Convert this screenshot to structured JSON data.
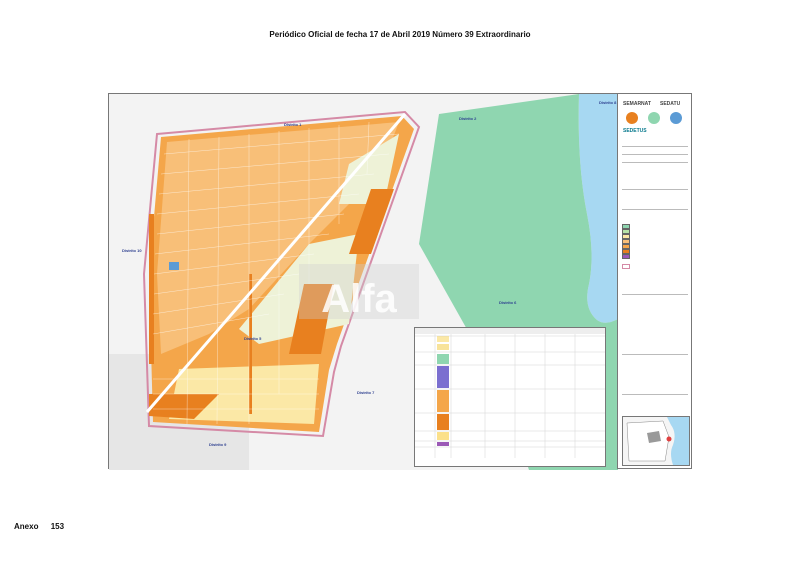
{
  "header": {
    "title": "Periódico Oficial de fecha 17  de Abril  2019  Número 39 Extraordinario"
  },
  "footer": {
    "label": "Anexo",
    "page": "153"
  },
  "map": {
    "watermark": "Alfa",
    "districts": [
      {
        "id": "d8",
        "label": "Distrito 8"
      },
      {
        "id": "d1",
        "label": "Distrito 1"
      },
      {
        "id": "d2",
        "label": "Distrito 2"
      },
      {
        "id": "d10",
        "label": "Distrito 10"
      },
      {
        "id": "d6",
        "label": "Distrito 6"
      },
      {
        "id": "d5",
        "label": "Distrito 5"
      },
      {
        "id": "d7",
        "label": "Distrito 7"
      },
      {
        "id": "d9",
        "label": "Distrito 9"
      }
    ],
    "colors": {
      "urban_orange": "#f4a64a",
      "dark_orange": "#e8801f",
      "light_yellow": "#fbe8a6",
      "green_reserve": "#8fd6b0",
      "water": "#a7d8f2",
      "boundary": "#d58aa6",
      "road_white": "#ffffff",
      "blue_lot": "#5b9bd5",
      "purple": "#9b59b6"
    }
  },
  "panel": {
    "logos": [
      "SEMARNAT",
      "SEDATU"
    ],
    "lower_logo": "SEDETUS"
  }
}
